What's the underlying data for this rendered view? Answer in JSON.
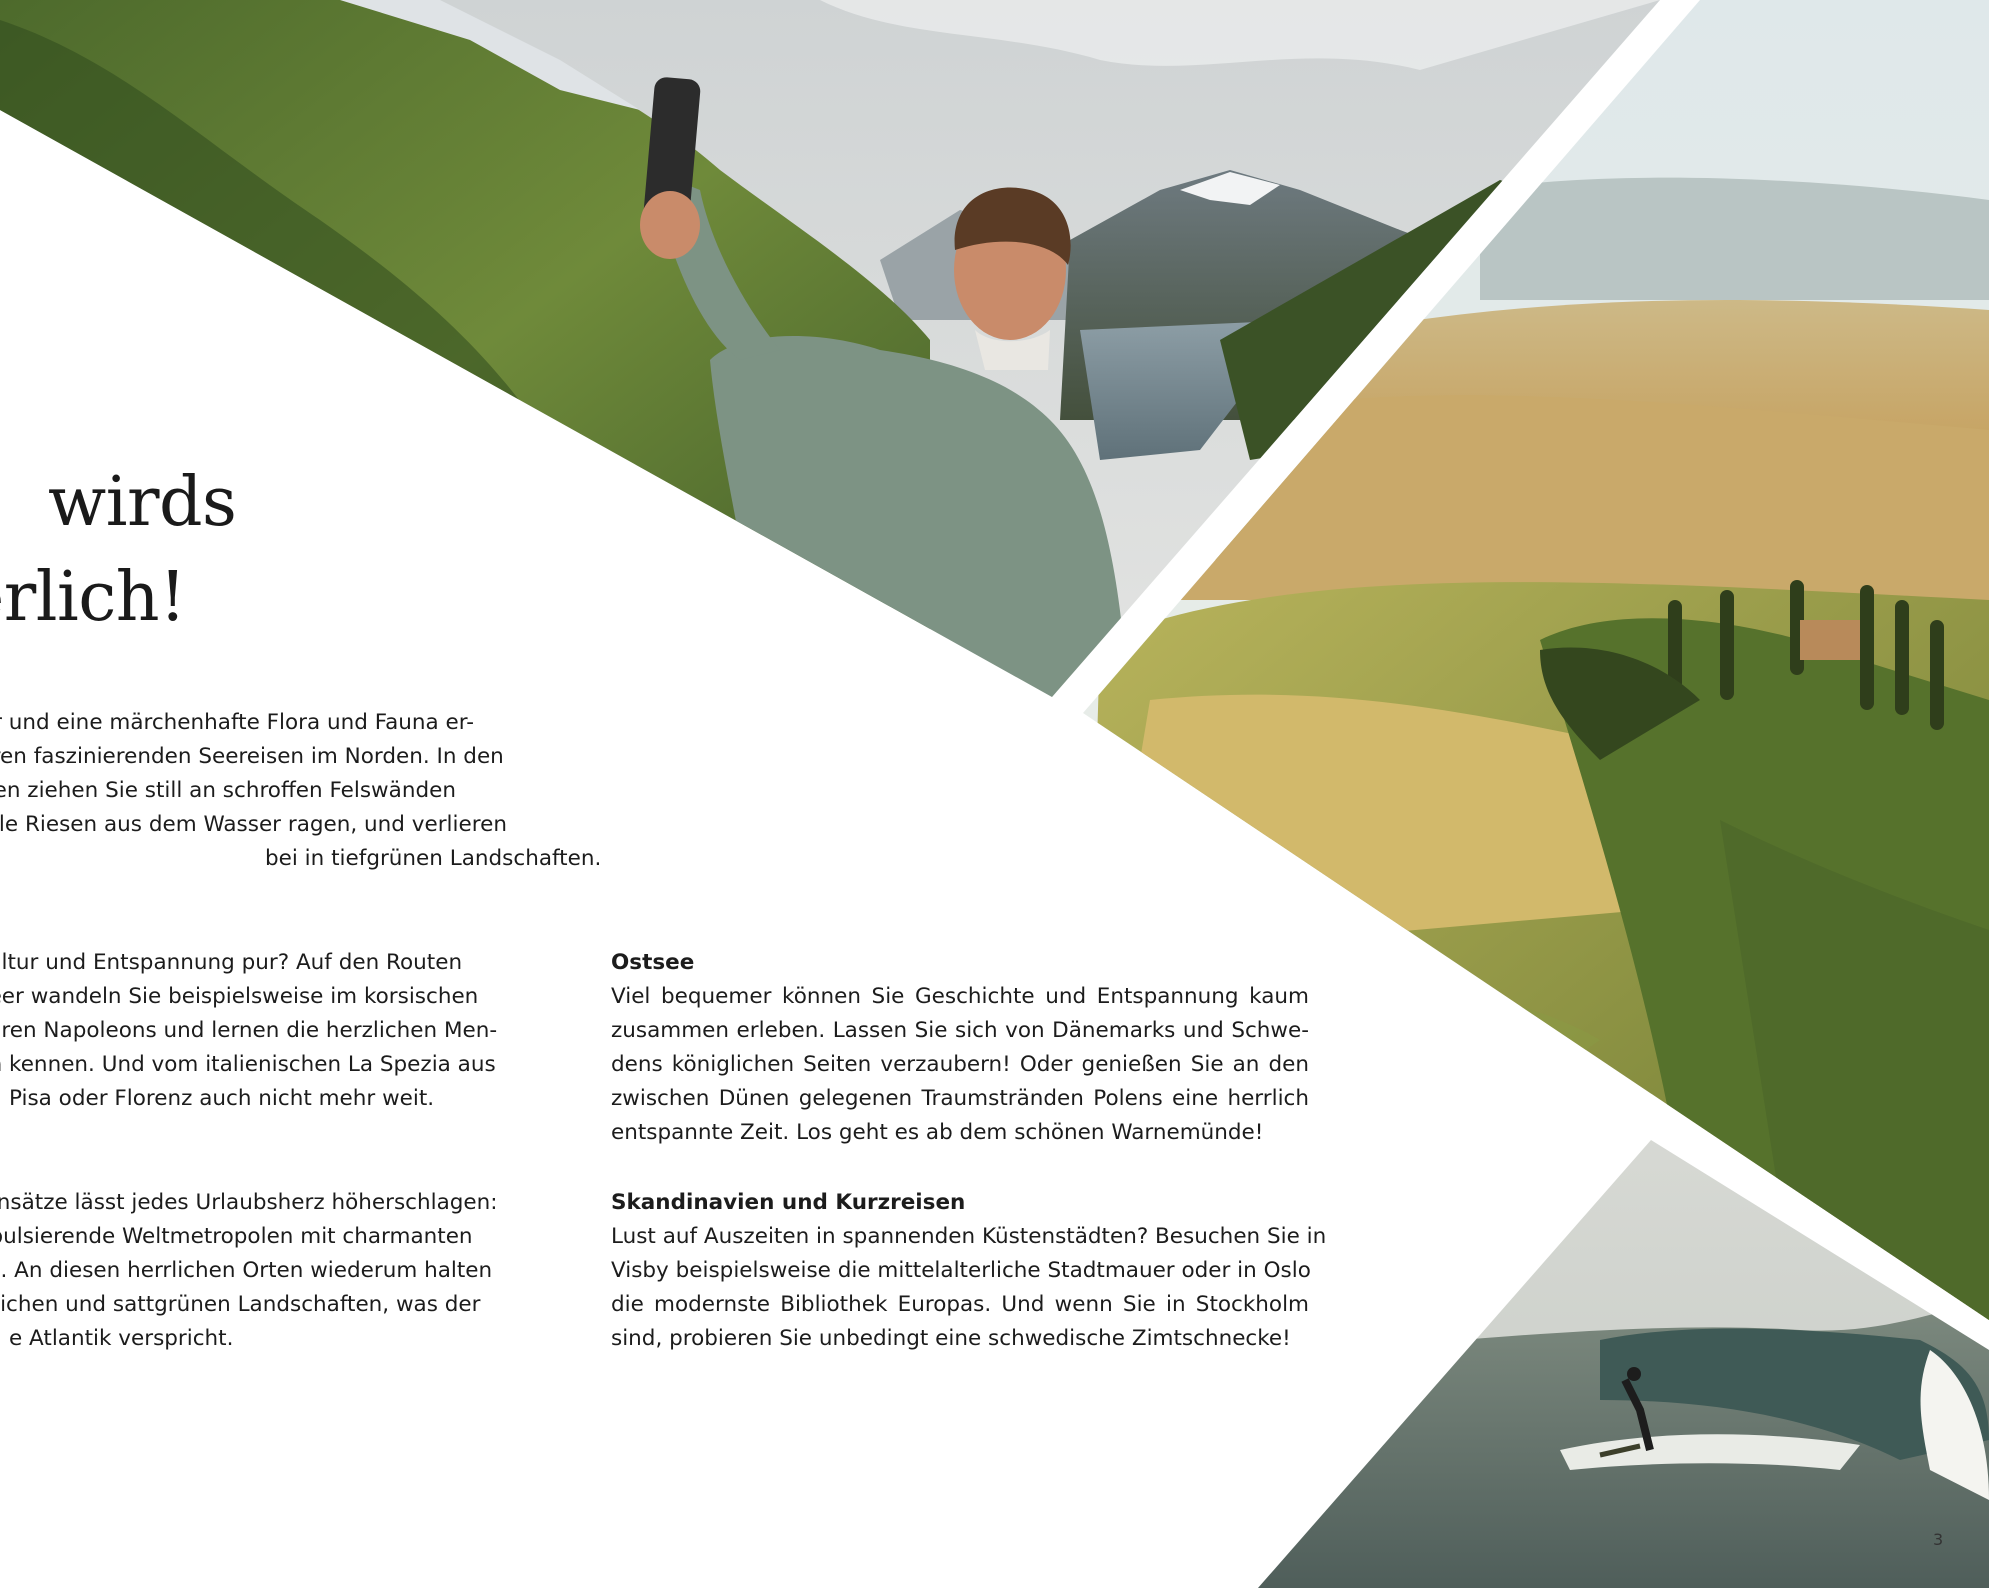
{
  "headline": {
    "line1": "wirds",
    "line2": "merlich!"
  },
  "paragraphs": {
    "norway": [
      "ichter und eine märchenhafte Flora und Fauna er-",
      "unseren faszinierenden Seereisen im Norden. In den",
      "Fjorden ziehen Sie still an schroffen Felswänden",
      "e kahle Riesen aus dem Wasser ragen, und verlieren",
      "bei in tiefgrünen Landschaften."
    ],
    "mediterranean": [
      "nit Kultur und Entspannung pur? Auf den Routen",
      "telmeer wandeln Sie beispielsweise im korsischen",
      "n Spuren Napoleons und lernen die herzlichen Men-",
      "ergen kennen. Und vom italienischen La Spezia aus",
      "Pisa oder Florenz auch nicht mehr weit."
    ],
    "atlantic": [
      "Gegensätze lässt jedes Urlaubsherz höherschlagen:",
      "sich pulsierende Weltmetropolen mit charmanten",
      "en ab. An diesen herrlichen Orten wiederum halten",
      "ngsreichen und sattgrünen Landschaften, was der",
      "e Atlantik verspricht."
    ],
    "ostsee": {
      "title": "Ostsee",
      "lines": [
        "Viel bequemer können Sie Geschichte und Entspannung kaum",
        "zusammen erleben. Lassen Sie sich von Dänemarks und Schwe-",
        "dens königlichen Seiten verzaubern! Oder genießen Sie an den",
        "zwischen Dünen gelegenen Traumstränden Polens eine herrlich",
        "entspannte Zeit. Los geht es ab dem schönen Warnemünde!"
      ]
    },
    "skandinavien": {
      "title": "Skandinavien und Kurzreisen",
      "lines": [
        "Lust auf Auszeiten in spannenden Küstenstädten? Besuchen Sie in",
        "Visby beispielsweise die mittelalterliche Stadtmauer oder in Oslo",
        "die modernste Bibliothek Europas. Und wenn Sie in Stockholm",
        "sind, probieren Sie unbedingt eine schwedische Zimtschnecke!"
      ]
    }
  },
  "page_number": "3"
}
